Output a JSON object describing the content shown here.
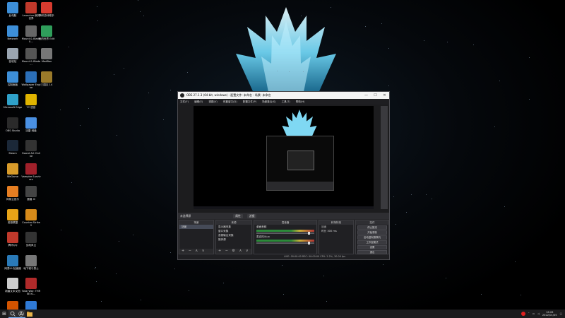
{
  "desktop_icons": [
    {
      "label": "此电脑",
      "color": "#3d8fd8"
    },
    {
      "label": "Launcher-我的世界",
      "color": "#c0392b"
    },
    {
      "label": "腾讯游戏助手",
      "color": "#d63b2f"
    },
    {
      "label": "Network",
      "color": "#3d8fd8"
    },
    {
      "label": "Mount & Blade II...",
      "color": "#666"
    },
    {
      "label": "我的世界 Edit",
      "color": "#2f9e5b"
    },
    {
      "label": "回收站",
      "color": "#9aa5b1"
    },
    {
      "label": "Mount & Blade ...",
      "color": "#555"
    },
    {
      "label": "MedBox",
      "color": "#777"
    },
    {
      "label": "控制面板",
      "color": "#3d8fd8"
    },
    {
      "label": "Wallpaper Engine",
      "color": "#2b6fb8"
    },
    {
      "label": "三国志 14",
      "color": "#9a7a2a"
    },
    {
      "label": "Microsoft Edge",
      "color": "#2fa1c9"
    },
    {
      "label": "YY 语音",
      "color": "#e0b400"
    },
    {
      "label": "",
      "color": "transparent"
    },
    {
      "label": "OBS Studio",
      "color": "#2a2a2a"
    },
    {
      "label": "迅雷 网盘",
      "color": "#4a90e2"
    },
    {
      "label": "",
      "color": "transparent"
    },
    {
      "label": "Steam",
      "color": "#1b2838"
    },
    {
      "label": "Sword Art Online",
      "color": "#333"
    },
    {
      "label": "",
      "color": "transparent"
    },
    {
      "label": "WeGame",
      "color": "#d89b2a"
    },
    {
      "label": "Vampire Survivors",
      "color": "#a0202a"
    },
    {
      "label": "",
      "color": "transparent"
    },
    {
      "label": "网易云音乐",
      "color": "#e67e22"
    },
    {
      "label": "魔兽 III",
      "color": "#444"
    },
    {
      "label": "",
      "color": "transparent"
    },
    {
      "label": "英雄联盟",
      "color": "#e8a317"
    },
    {
      "label": "Counter-Strike 2",
      "color": "#d88b1a"
    },
    {
      "label": "",
      "color": "transparent"
    },
    {
      "label": "腾讯QQ",
      "color": "#c0392b"
    },
    {
      "label": "战地风云",
      "color": "#333"
    },
    {
      "label": "",
      "color": "transparent"
    },
    {
      "label": "网易UU加速器",
      "color": "#2a7ab8"
    },
    {
      "label": "地下城与勇士",
      "color": "#777"
    },
    {
      "label": "",
      "color": "transparent"
    },
    {
      "label": "新建文本文档",
      "color": "#ccc"
    },
    {
      "label": "Total War: THREE KI...",
      "color": "#b02a2a"
    },
    {
      "label": "",
      "color": "transparent"
    },
    {
      "label": "腾讯 游戏平台",
      "color": "#d35400"
    },
    {
      "label": "迅雷",
      "color": "#2f7ad6"
    },
    {
      "label": "",
      "color": "transparent"
    }
  ],
  "obs": {
    "title": "OBS 27.1.3 (64-bit, windows) - 配置文件: 未命名 - 场景: 未命名",
    "minimize": "—",
    "maximize": "☐",
    "close": "✕",
    "menu": [
      "文件(F)",
      "编辑(E)",
      "视图(V)",
      "停靠窗口(D)",
      "配置文件(P)",
      "场景集合(S)",
      "工具(T)",
      "帮助(H)"
    ],
    "docks_title": "未选择源",
    "dock_tags": [
      "属性",
      "滤镜"
    ],
    "scenes": {
      "title": "场景",
      "items": [
        "场景"
      ],
      "footer": "+ − ∧ ∨"
    },
    "sources": {
      "title": "来源",
      "items": [
        "显示器采集",
        "窗口采集",
        "音频输出采集",
        "媒体源"
      ],
      "footer": "+ − ⚙ ∧ ∨"
    },
    "mixer": {
      "title": "混音器",
      "channels": [
        "桌面音频",
        "麦克风/Aux"
      ]
    },
    "transitions": {
      "title": "转场特效",
      "type": "淡出",
      "duration_label": "时长",
      "duration": "300 ms"
    },
    "controls": {
      "title": "控件",
      "buttons": [
        "停止推流",
        "开始录制",
        "启动虚拟摄像机",
        "工作室模式",
        "设置",
        "退出"
      ]
    },
    "status": "LIVE: 00:00:00   REC: 00:00:00   CPU: 2.2%, 30.00 fps"
  },
  "taskbar": {
    "start_icon": "windows-logo",
    "apps": [
      "search",
      "obs",
      "file-explorer"
    ],
    "tray_time": "16:26",
    "tray_date": "2022/01/05"
  }
}
